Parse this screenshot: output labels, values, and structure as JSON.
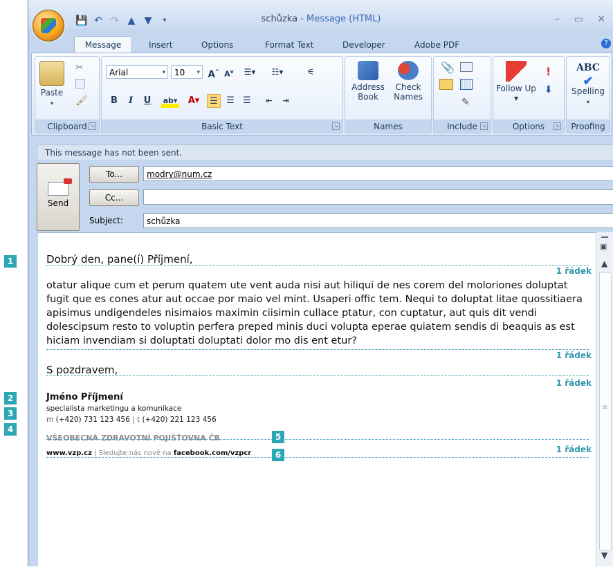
{
  "window": {
    "doc_title": "schůzka",
    "title_sep": " - ",
    "app_title": "Message (HTML)",
    "controls": "– ▭ ✕"
  },
  "qat": [
    "💾",
    "↶",
    "↷",
    "▲",
    "▼",
    "▾"
  ],
  "tabs": [
    "Message",
    "Insert",
    "Options",
    "Format Text",
    "Developer",
    "Adobe PDF"
  ],
  "ribbon": {
    "clipboard": {
      "label": "Clipboard",
      "paste": "Paste"
    },
    "basic_text": {
      "label": "Basic Text",
      "font": "Arial",
      "size": "10"
    },
    "names": {
      "label": "Names",
      "address_book": "Address Book",
      "check_names": "Check Names"
    },
    "include": {
      "label": "Include"
    },
    "options": {
      "label": "Options",
      "follow_up": "Follow Up ▾"
    },
    "proofing": {
      "label": "Proofing",
      "spelling": "Spelling"
    }
  },
  "notice": "This message has not been sent.",
  "header": {
    "send": "Send",
    "to_btn": "To...",
    "cc_btn": "Cc...",
    "subject_label": "Subject:",
    "to_value": "modry@num.cz",
    "cc_value": "",
    "subject_value": "schůzka"
  },
  "body": {
    "greeting": "Dobrý den, pane(í) Příjmení,",
    "paragraph": "otatur alique cum et perum quatem ute vent auda nisi aut hiliqui de nes corem del moloriones doluptat fugit que es cones atur aut occae por maio vel mint. Usaperi offic tem. Nequi to doluptat litae quossitiaera apisimus undigendeles nisimaios maximin ciisimin cullace ptatur, con cuptatur, aut quis dit vendi dolescipsum resto to voluptin perfera preped minis duci volupta eperae quiatem sendis di beaquis as est hiciam invendiam si doluptati doluptati dolor mo dis ent etur?",
    "closing": "S pozdravem,",
    "radek": "1 řádek",
    "sig_name": "Jméno Příjmení",
    "sig_role": "specialista marketingu a komunikace",
    "sig_phone_m": "m",
    "sig_phone_m_num": "(+420) 731 123 456",
    "sig_sep": "|",
    "sig_phone_t": "t",
    "sig_phone_t_num": "(+420) 221 123 456",
    "company": "VŠEOBECNÁ ZDRAVOTNÍ POJIŠŤOVNA ČR",
    "web": "www.vzp.cz",
    "web_sep": " | ",
    "follow_text": "Sledujte nás nově na ",
    "facebook": "facebook.com/vzpcr"
  },
  "markers": [
    "1",
    "2",
    "3",
    "4",
    "5",
    "6"
  ],
  "colors": {
    "accent": "#2ea7b4",
    "ribbon": "#dce8f6"
  }
}
